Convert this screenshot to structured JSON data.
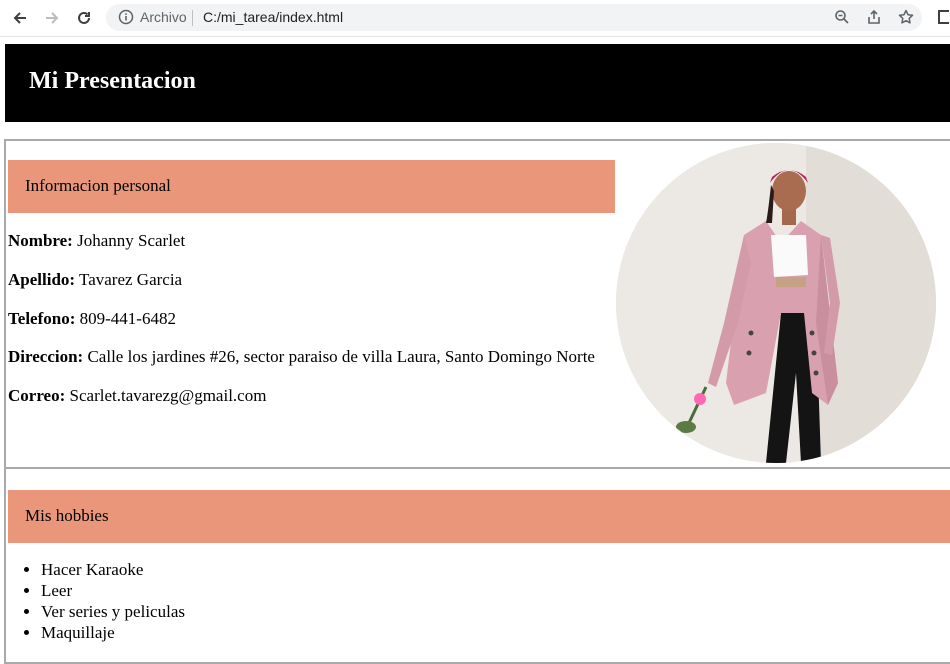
{
  "browser": {
    "scheme_label": "Archivo",
    "url": "C:/mi_tarea/index.html"
  },
  "header": {
    "title": "Mi Presentacion",
    "background": "#000000",
    "color": "#ffffff"
  },
  "personal": {
    "heading": "Informacion personal",
    "accent": "#e9967a",
    "fields": [
      {
        "label": "Nombre:",
        "value": "Johanny Scarlet"
      },
      {
        "label": "Apellido:",
        "value": "Tavarez Garcia"
      },
      {
        "label": "Telefono:",
        "value": "809-441-6482"
      },
      {
        "label": "Direccion:",
        "value": "Calle los jardines #26, sector paraiso de villa Laura, Santo Domingo Norte"
      },
      {
        "label": "Correo:",
        "value": "Scarlet.tavarezg@gmail.com"
      }
    ]
  },
  "hobbies": {
    "heading": "Mis hobbies",
    "items": [
      "Hacer Karaoke",
      "Leer",
      "Ver series y peliculas",
      "Maquillaje"
    ]
  }
}
